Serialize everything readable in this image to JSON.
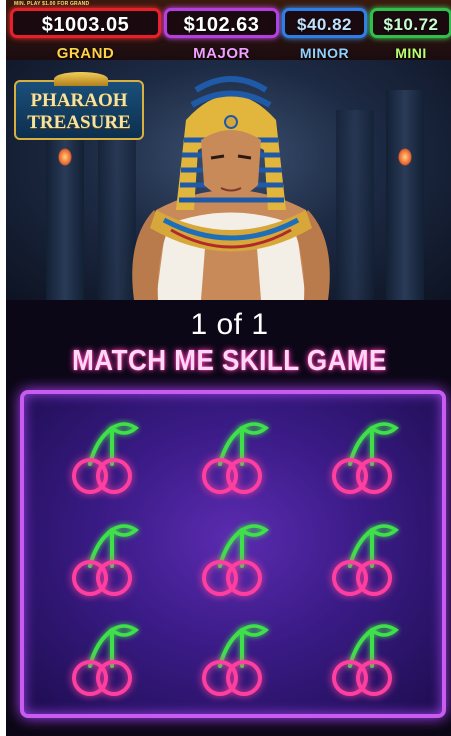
{
  "jackpots": {
    "fine_print": "MIN. PLAY $1.00 FOR GRAND",
    "grand": {
      "value": "$1003.05",
      "label": "GRAND"
    },
    "major": {
      "value": "$102.63",
      "label": "MAJOR"
    },
    "minor": {
      "value": "$40.82",
      "label": "MINOR"
    },
    "mini": {
      "value": "$10.72",
      "label": "MINI"
    }
  },
  "logo": {
    "line1": "PHARAOH",
    "line2": "TREASURE"
  },
  "game": {
    "counter": "1 of 1",
    "title": "MATCH ME SKILL GAME",
    "tiles": [
      {
        "icon": "cherry-icon"
      },
      {
        "icon": "cherry-icon"
      },
      {
        "icon": "cherry-icon"
      },
      {
        "icon": "cherry-icon"
      },
      {
        "icon": "cherry-icon"
      },
      {
        "icon": "cherry-icon"
      },
      {
        "icon": "cherry-icon"
      },
      {
        "icon": "cherry-icon"
      },
      {
        "icon": "cherry-icon"
      }
    ]
  },
  "colors": {
    "grand_border": "#e8202a",
    "major_border": "#b63de0",
    "minor_border": "#2f7de8",
    "mini_border": "#2fbf4a",
    "board_border": "#c95cf0",
    "cherry_neon": "#ff3fa0",
    "stem_neon": "#3fe04a"
  }
}
